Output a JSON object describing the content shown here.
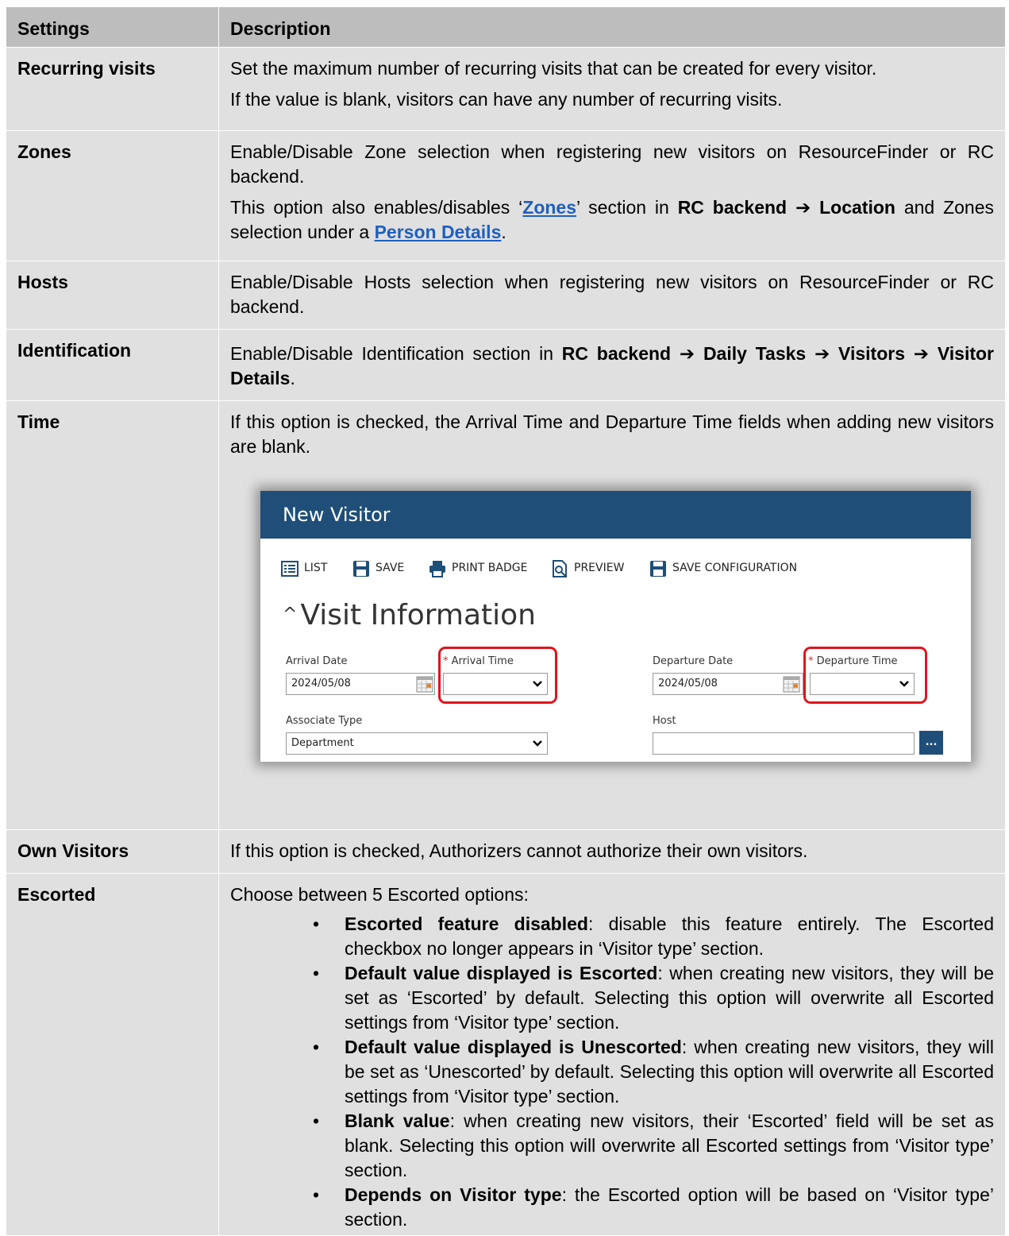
{
  "header": {
    "settings": "Settings",
    "description": "Description"
  },
  "rows": {
    "recurring": {
      "key": "Recurring visits",
      "p1": "Set the maximum number of recurring visits that can be created for every visitor.",
      "p2": "If the value is blank, visitors can have any number of recurring visits."
    },
    "zones": {
      "key": "Zones",
      "p1": "Enable/Disable Zone selection when registering new visitors on ResourceFinder or RC backend.",
      "p2_a": "This option also enables/disables ‘",
      "p2_link": "Zones",
      "p2_b": "’ section in ",
      "p2_bold": "RC backend ➔ Location",
      "p2_c": " and Zones selection under a ",
      "p2_link2": "Person Details",
      "p2_d": "."
    },
    "hosts": {
      "key": "Hosts",
      "p1": "Enable/Disable Hosts selection when registering new visitors on ResourceFinder or RC backend."
    },
    "identification": {
      "key": "Identification",
      "p1_a": "Enable/Disable Identification section in ",
      "p1_bold": "RC backend ➔ Daily Tasks ➔ Visitors ➔ Visitor Details",
      "p1_b": "."
    },
    "time": {
      "key": "Time",
      "p1": "If this option is checked, the Arrival Time and Departure Time fields when adding new visitors are blank."
    },
    "own_visitors": {
      "key": "Own Visitors",
      "p1": "If this option is checked, Authorizers cannot authorize their own visitors."
    },
    "escorted": {
      "key": "Escorted",
      "intro": "Choose between 5 Escorted options:",
      "items": [
        {
          "bold": "Escorted feature disabled",
          "text": ": disable this feature entirely. The Escorted checkbox no longer appears in ‘Visitor type’ section."
        },
        {
          "bold": "Default value displayed is Escorted",
          "text": ": when creating new visitors, they will be set as ‘Escorted’ by default. Selecting this option will overwrite all Escorted settings from ‘Visitor type’ section."
        },
        {
          "bold": "Default value displayed is Unescorted",
          "text": ": when creating new visitors, they will be set as ‘Unescorted’ by default. Selecting this option will overwrite all Escorted settings from ‘Visitor type’ section."
        },
        {
          "bold": "Blank value",
          "text": ": when creating new visitors, their ‘Escorted’ field will be set as blank. Selecting this option will overwrite all Escorted settings from ‘Visitor type’ section."
        },
        {
          "bold": "Depends on Visitor type",
          "text": ": the Escorted option will be based on ‘Visitor type’ section."
        }
      ]
    }
  },
  "screenshot": {
    "title": "New Visitor",
    "toolbar": {
      "list": "LIST",
      "save": "SAVE",
      "print": "PRINT BADGE",
      "preview": "PREVIEW",
      "save_config": "SAVE CONFIGURATION"
    },
    "section": "Visit Information",
    "arrival_date_label": "Arrival Date",
    "arrival_date_value": "2024/05/08",
    "arrival_time_label": "Arrival Time",
    "departure_date_label": "Departure Date",
    "departure_date_value": "2024/05/08",
    "departure_time_label": "Departure Time",
    "associate_type_label": "Associate Type",
    "associate_type_value": "Department",
    "host_label": "Host",
    "host_button": "...",
    "required_mark": "*",
    "accent": "#1f4e79",
    "highlight": "#e0141e"
  }
}
